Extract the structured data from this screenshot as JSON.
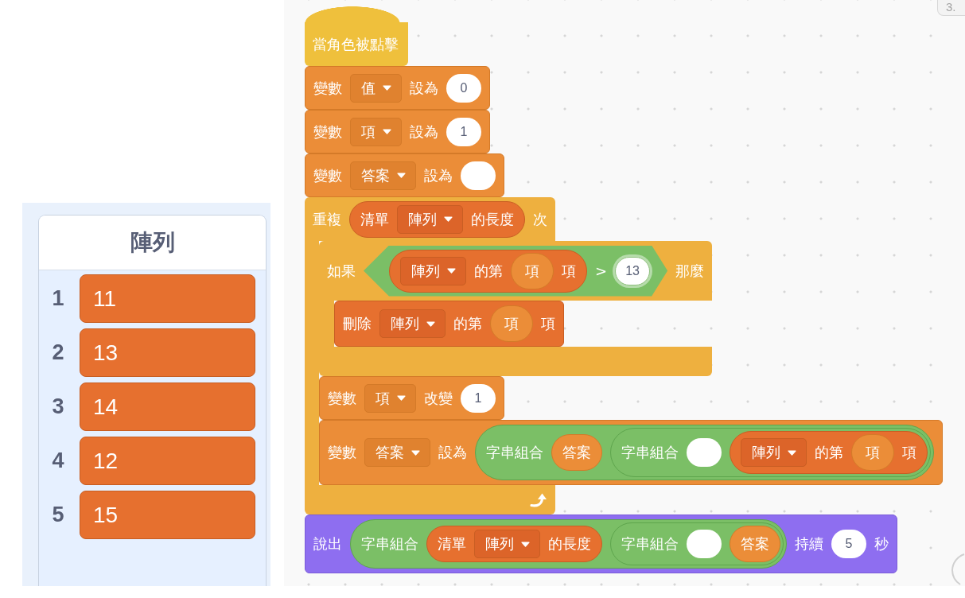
{
  "list_monitor": {
    "title": "陣列",
    "items": [
      {
        "index": "1",
        "value": "11"
      },
      {
        "index": "2",
        "value": "13"
      },
      {
        "index": "3",
        "value": "14"
      },
      {
        "index": "4",
        "value": "12"
      },
      {
        "index": "5",
        "value": "15"
      }
    ]
  },
  "corner_button": {
    "label": "3."
  },
  "script": [
    {
      "kind": "hat",
      "parts": [
        {
          "kind": "label",
          "text": "當角色被點擊"
        }
      ]
    },
    {
      "kind": "variable",
      "parts": [
        {
          "kind": "label",
          "text": "變數"
        },
        {
          "kind": "dropdown",
          "text": "值"
        },
        {
          "kind": "label",
          "text": "設為"
        },
        {
          "kind": "input",
          "text": "0"
        }
      ]
    },
    {
      "kind": "variable",
      "parts": [
        {
          "kind": "label",
          "text": "變數"
        },
        {
          "kind": "dropdown",
          "text": "項"
        },
        {
          "kind": "label",
          "text": "設為"
        },
        {
          "kind": "input",
          "text": "1"
        }
      ]
    },
    {
      "kind": "variable",
      "parts": [
        {
          "kind": "label",
          "text": "變數"
        },
        {
          "kind": "dropdown",
          "text": "答案"
        },
        {
          "kind": "label",
          "text": "設為"
        },
        {
          "kind": "input"
        }
      ]
    },
    {
      "kind": "repeat",
      "parts": [
        {
          "kind": "label",
          "text": "重複"
        },
        {
          "kind": "list",
          "parts": [
            {
              "kind": "label",
              "text": "清單"
            },
            {
              "kind": "dropdown",
              "text": "陣列"
            },
            {
              "kind": "label",
              "text": "的長度"
            }
          ]
        },
        {
          "kind": "label",
          "text": "次"
        }
      ],
      "children": [
        {
          "kind": "if",
          "parts": [
            {
              "kind": "label",
              "text": "如果"
            },
            {
              "kind": "condition",
              "parts": [
                {
                  "kind": "list",
                  "parts": [
                    {
                      "kind": "dropdown",
                      "text": "陣列"
                    },
                    {
                      "kind": "label",
                      "text": "的第"
                    },
                    {
                      "kind": "variable",
                      "parts": [
                        {
                          "kind": "label",
                          "text": "項"
                        }
                      ]
                    },
                    {
                      "kind": "label",
                      "text": "項"
                    }
                  ]
                },
                {
                  "kind": "label",
                  "text": ">"
                },
                {
                  "kind": "input",
                  "text": "13",
                  "highlighted": true
                }
              ]
            },
            {
              "kind": "label",
              "text": "那麼"
            }
          ],
          "children": [
            {
              "kind": "list",
              "parts": [
                {
                  "kind": "label",
                  "text": "刪除"
                },
                {
                  "kind": "dropdown",
                  "text": "陣列"
                },
                {
                  "kind": "label",
                  "text": "的第"
                },
                {
                  "kind": "variable",
                  "parts": [
                    {
                      "kind": "label",
                      "text": "項"
                    }
                  ]
                },
                {
                  "kind": "label",
                  "text": "項"
                }
              ]
            }
          ]
        },
        {
          "kind": "variable",
          "parts": [
            {
              "kind": "label",
              "text": "變數"
            },
            {
              "kind": "dropdown",
              "text": "項"
            },
            {
              "kind": "label",
              "text": "改變"
            },
            {
              "kind": "input",
              "text": "1"
            }
          ]
        },
        {
          "kind": "variable",
          "parts": [
            {
              "kind": "label",
              "text": "變數"
            },
            {
              "kind": "dropdown",
              "text": "答案"
            },
            {
              "kind": "label",
              "text": "設為"
            },
            {
              "kind": "join",
              "parts": [
                {
                  "kind": "label",
                  "text": "字串組合"
                },
                {
                  "kind": "variable",
                  "parts": [
                    {
                      "kind": "label",
                      "text": "答案"
                    }
                  ]
                },
                {
                  "kind": "join",
                  "parts": [
                    {
                      "kind": "label",
                      "text": "字串組合"
                    },
                    {
                      "kind": "input"
                    },
                    {
                      "kind": "list",
                      "parts": [
                        {
                          "kind": "dropdown",
                          "text": "陣列"
                        },
                        {
                          "kind": "label",
                          "text": "的第"
                        },
                        {
                          "kind": "variable",
                          "parts": [
                            {
                              "kind": "label",
                              "text": "項"
                            }
                          ]
                        },
                        {
                          "kind": "label",
                          "text": "項"
                        }
                      ]
                    }
                  ]
                }
              ]
            }
          ]
        }
      ]
    },
    {
      "kind": "looks",
      "parts": [
        {
          "kind": "label",
          "text": "說出"
        },
        {
          "kind": "join",
          "parts": [
            {
              "kind": "label",
              "text": "字串組合"
            },
            {
              "kind": "list",
              "parts": [
                {
                  "kind": "label",
                  "text": "清單"
                },
                {
                  "kind": "dropdown",
                  "text": "陣列"
                },
                {
                  "kind": "label",
                  "text": "的長度"
                }
              ]
            },
            {
              "kind": "join",
              "parts": [
                {
                  "kind": "label",
                  "text": "字串組合"
                },
                {
                  "kind": "input"
                },
                {
                  "kind": "variable",
                  "parts": [
                    {
                      "kind": "label",
                      "text": "答案"
                    }
                  ]
                }
              ]
            }
          ]
        },
        {
          "kind": "label",
          "text": "持續"
        },
        {
          "kind": "input",
          "text": "5"
        },
        {
          "kind": "label",
          "text": "秒"
        }
      ]
    }
  ]
}
